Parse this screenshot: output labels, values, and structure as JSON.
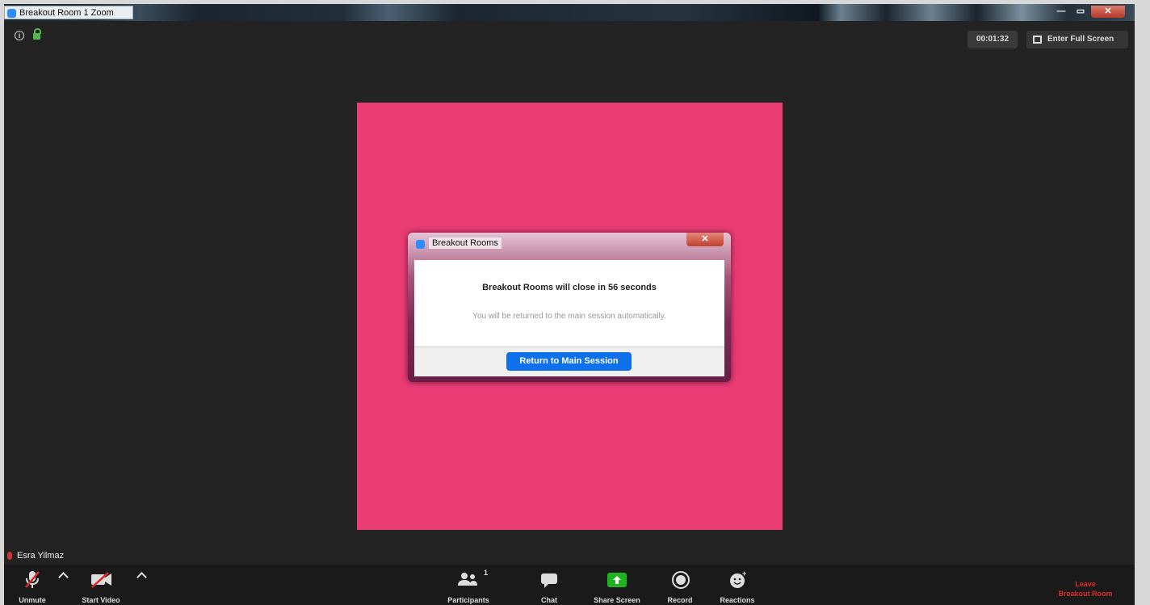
{
  "window": {
    "title": "Breakout Room 1  Zoom",
    "min_glyph": "—",
    "max_glyph": "▭",
    "close_glyph": "✕"
  },
  "topbar": {
    "info_glyph": "i",
    "timer": "00:01:32",
    "fullscreen_label": "Enter Full Screen"
  },
  "dialog": {
    "title": "Breakout Rooms",
    "close_glyph": "✕",
    "heading": "Breakout Rooms will close in 56 seconds",
    "message": "You will be returned to the main session automatically.",
    "button": "Return to Main Session"
  },
  "video": {
    "participant_name": "Esra Yilmaz",
    "tile_color": "#ea3d75"
  },
  "toolbar": {
    "unmute": "Unmute",
    "start_video": "Start Video",
    "participants": "Participants",
    "participants_count": "1",
    "chat": "Chat",
    "share_screen": "Share Screen",
    "record": "Record",
    "reactions": "Reactions",
    "leave_line1": "Leave",
    "leave_line2": "Breakout Room"
  },
  "colors": {
    "accent": "#0e71eb",
    "share_green": "#1fb41f",
    "leave_red": "#e02828"
  }
}
